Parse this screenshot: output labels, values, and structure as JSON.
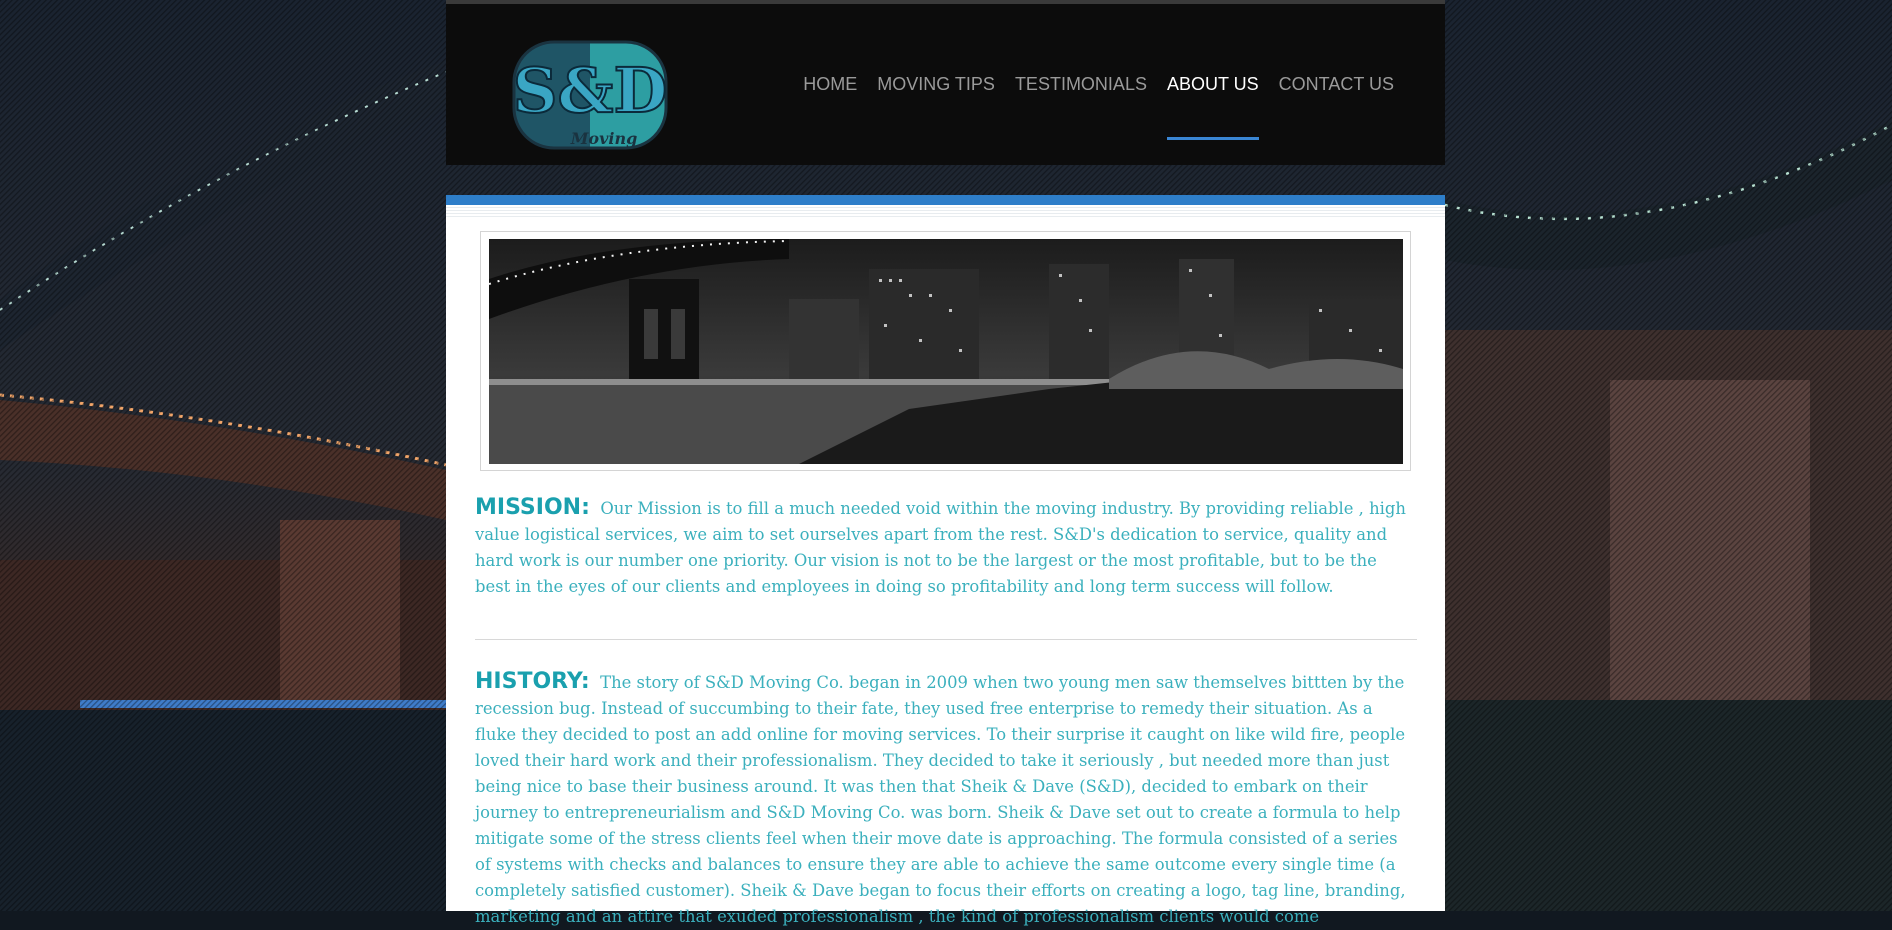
{
  "brand": {
    "logo_text": "S&D",
    "logo_subtext": "Moving",
    "accent_color": "#2e7ec9",
    "text_color": "#3bb0bd"
  },
  "nav": {
    "items": [
      {
        "label": "HOME",
        "active": false
      },
      {
        "label": "MOVING TIPS",
        "active": false
      },
      {
        "label": "TESTIMONIALS",
        "active": false
      },
      {
        "label": "ABOUT US",
        "active": true
      },
      {
        "label": "CONTACT US",
        "active": false
      }
    ]
  },
  "content": {
    "mission": {
      "label": "MISSION:",
      "text": "Our Mission is to fill a much needed void within the moving industry. By providing reliable , high value logistical services, we aim to set ourselves apart from the rest. S&D's dedication to service, quality  and hard work is our number one priority.  Our vision is not to be the largest or the most profitable, but to be the best in the eyes of our clients and employees  in doing so profitability and long term success will follow."
    },
    "history": {
      "label": "HISTORY:",
      "text": "The story of S&D Moving Co. began in 2009 when two young men saw themselves bittten by the recession bug.  Instead of succumbing to their fate, they used free enterprise to remedy their situation. As a fluke they decided to post an add online for moving services. To their surprise it caught on like wild fire, people loved their hard work and their professionalism. They decided to take it seriously , but needed more than just being nice to base their business around. It was then that Sheik & Dave (S&D), decided to embark on their journey to entrepreneurialism and S&D Moving Co. was born. Sheik & Dave set out to create a formula to help mitigate some of the stress clients feel when their move date is approaching. The formula consisted of a series of systems with checks and balances to ensure they are able to achieve the same outcome every single time (a completely satisfied customer). Sheik & Dave began to focus their efforts on creating a logo, tag line, branding, marketing and an attire that exuded professionalism , the kind of professionalism clients would come"
    }
  }
}
